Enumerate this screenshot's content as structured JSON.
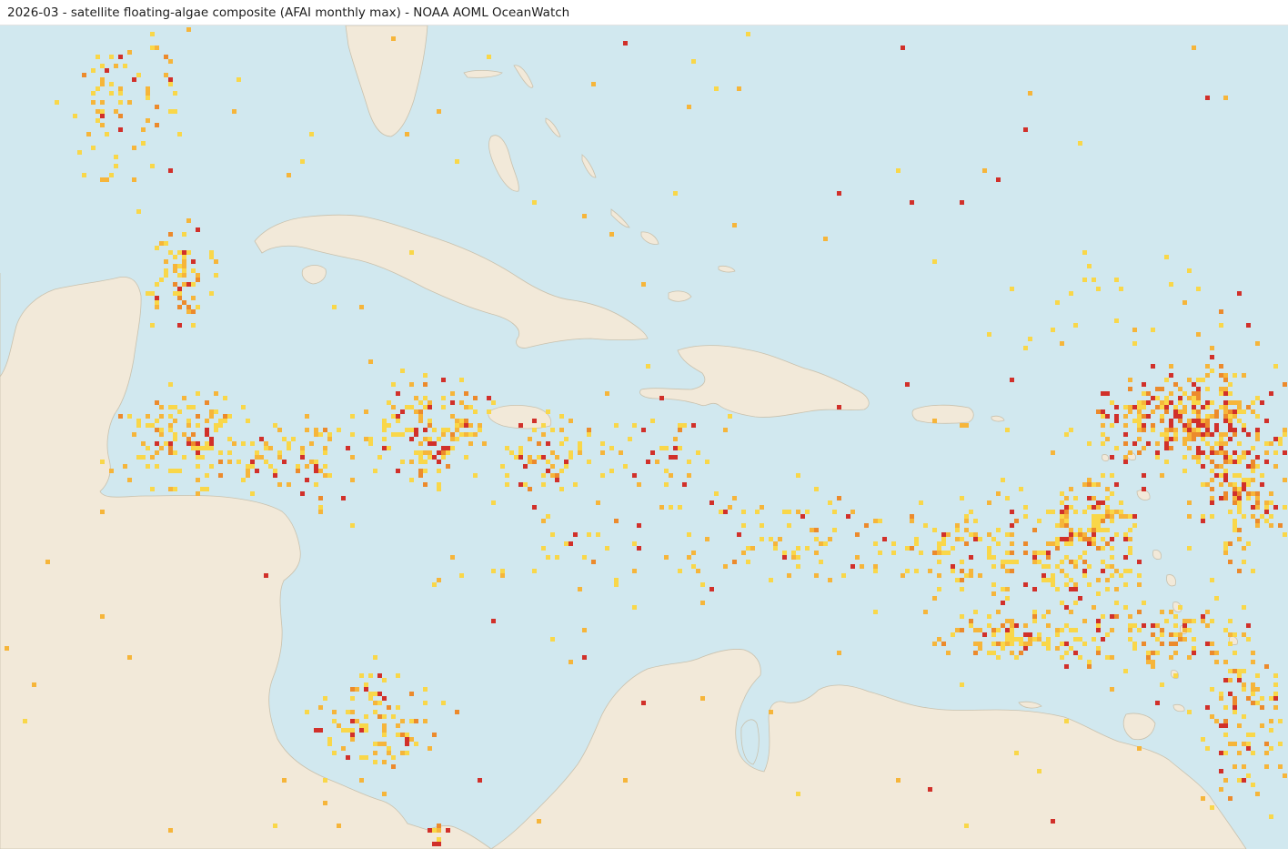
{
  "header": {
    "title": "2026-03 - satellite floating-algae composite (AFAI monthly max) - NOAA AOML OceanWatch"
  },
  "map": {
    "colors": {
      "ocean": "#d1e8ef",
      "land": "#f2e9d9",
      "coast": "#c9c1ad"
    },
    "legend_levels": [
      "#f9d749",
      "#f6b53a",
      "#ec8a2c",
      "#d1302a"
    ],
    "region": "Caribbean Sea / Gulf of Mexico / tropical Atlantic (no labels printed)"
  }
}
